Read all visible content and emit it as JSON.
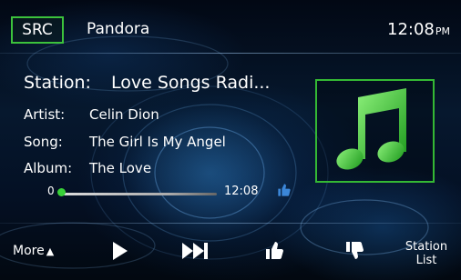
{
  "header": {
    "src_label": "SRC",
    "source": "Pandora",
    "time": "12:08",
    "ampm": "PM"
  },
  "track": {
    "station_label": "Station:",
    "station": "Love Songs Radi...",
    "artist_label": "Artist:",
    "artist": "Celin Dion",
    "song_label": "Song:",
    "song": "The Girl Is My Angel",
    "album_label": "Album:",
    "album": "The Love"
  },
  "progress": {
    "start": "0",
    "end": "12:08",
    "fraction": 0
  },
  "controls": {
    "more_label": "More",
    "station_list_line1": "Station",
    "station_list_line2": "List",
    "icons": [
      "play-icon",
      "next-track-icon",
      "thumbs-up-icon",
      "thumbs-down-icon"
    ]
  },
  "colors": {
    "accent": "#3cc23c",
    "thumb_small": "#3b86d8"
  }
}
